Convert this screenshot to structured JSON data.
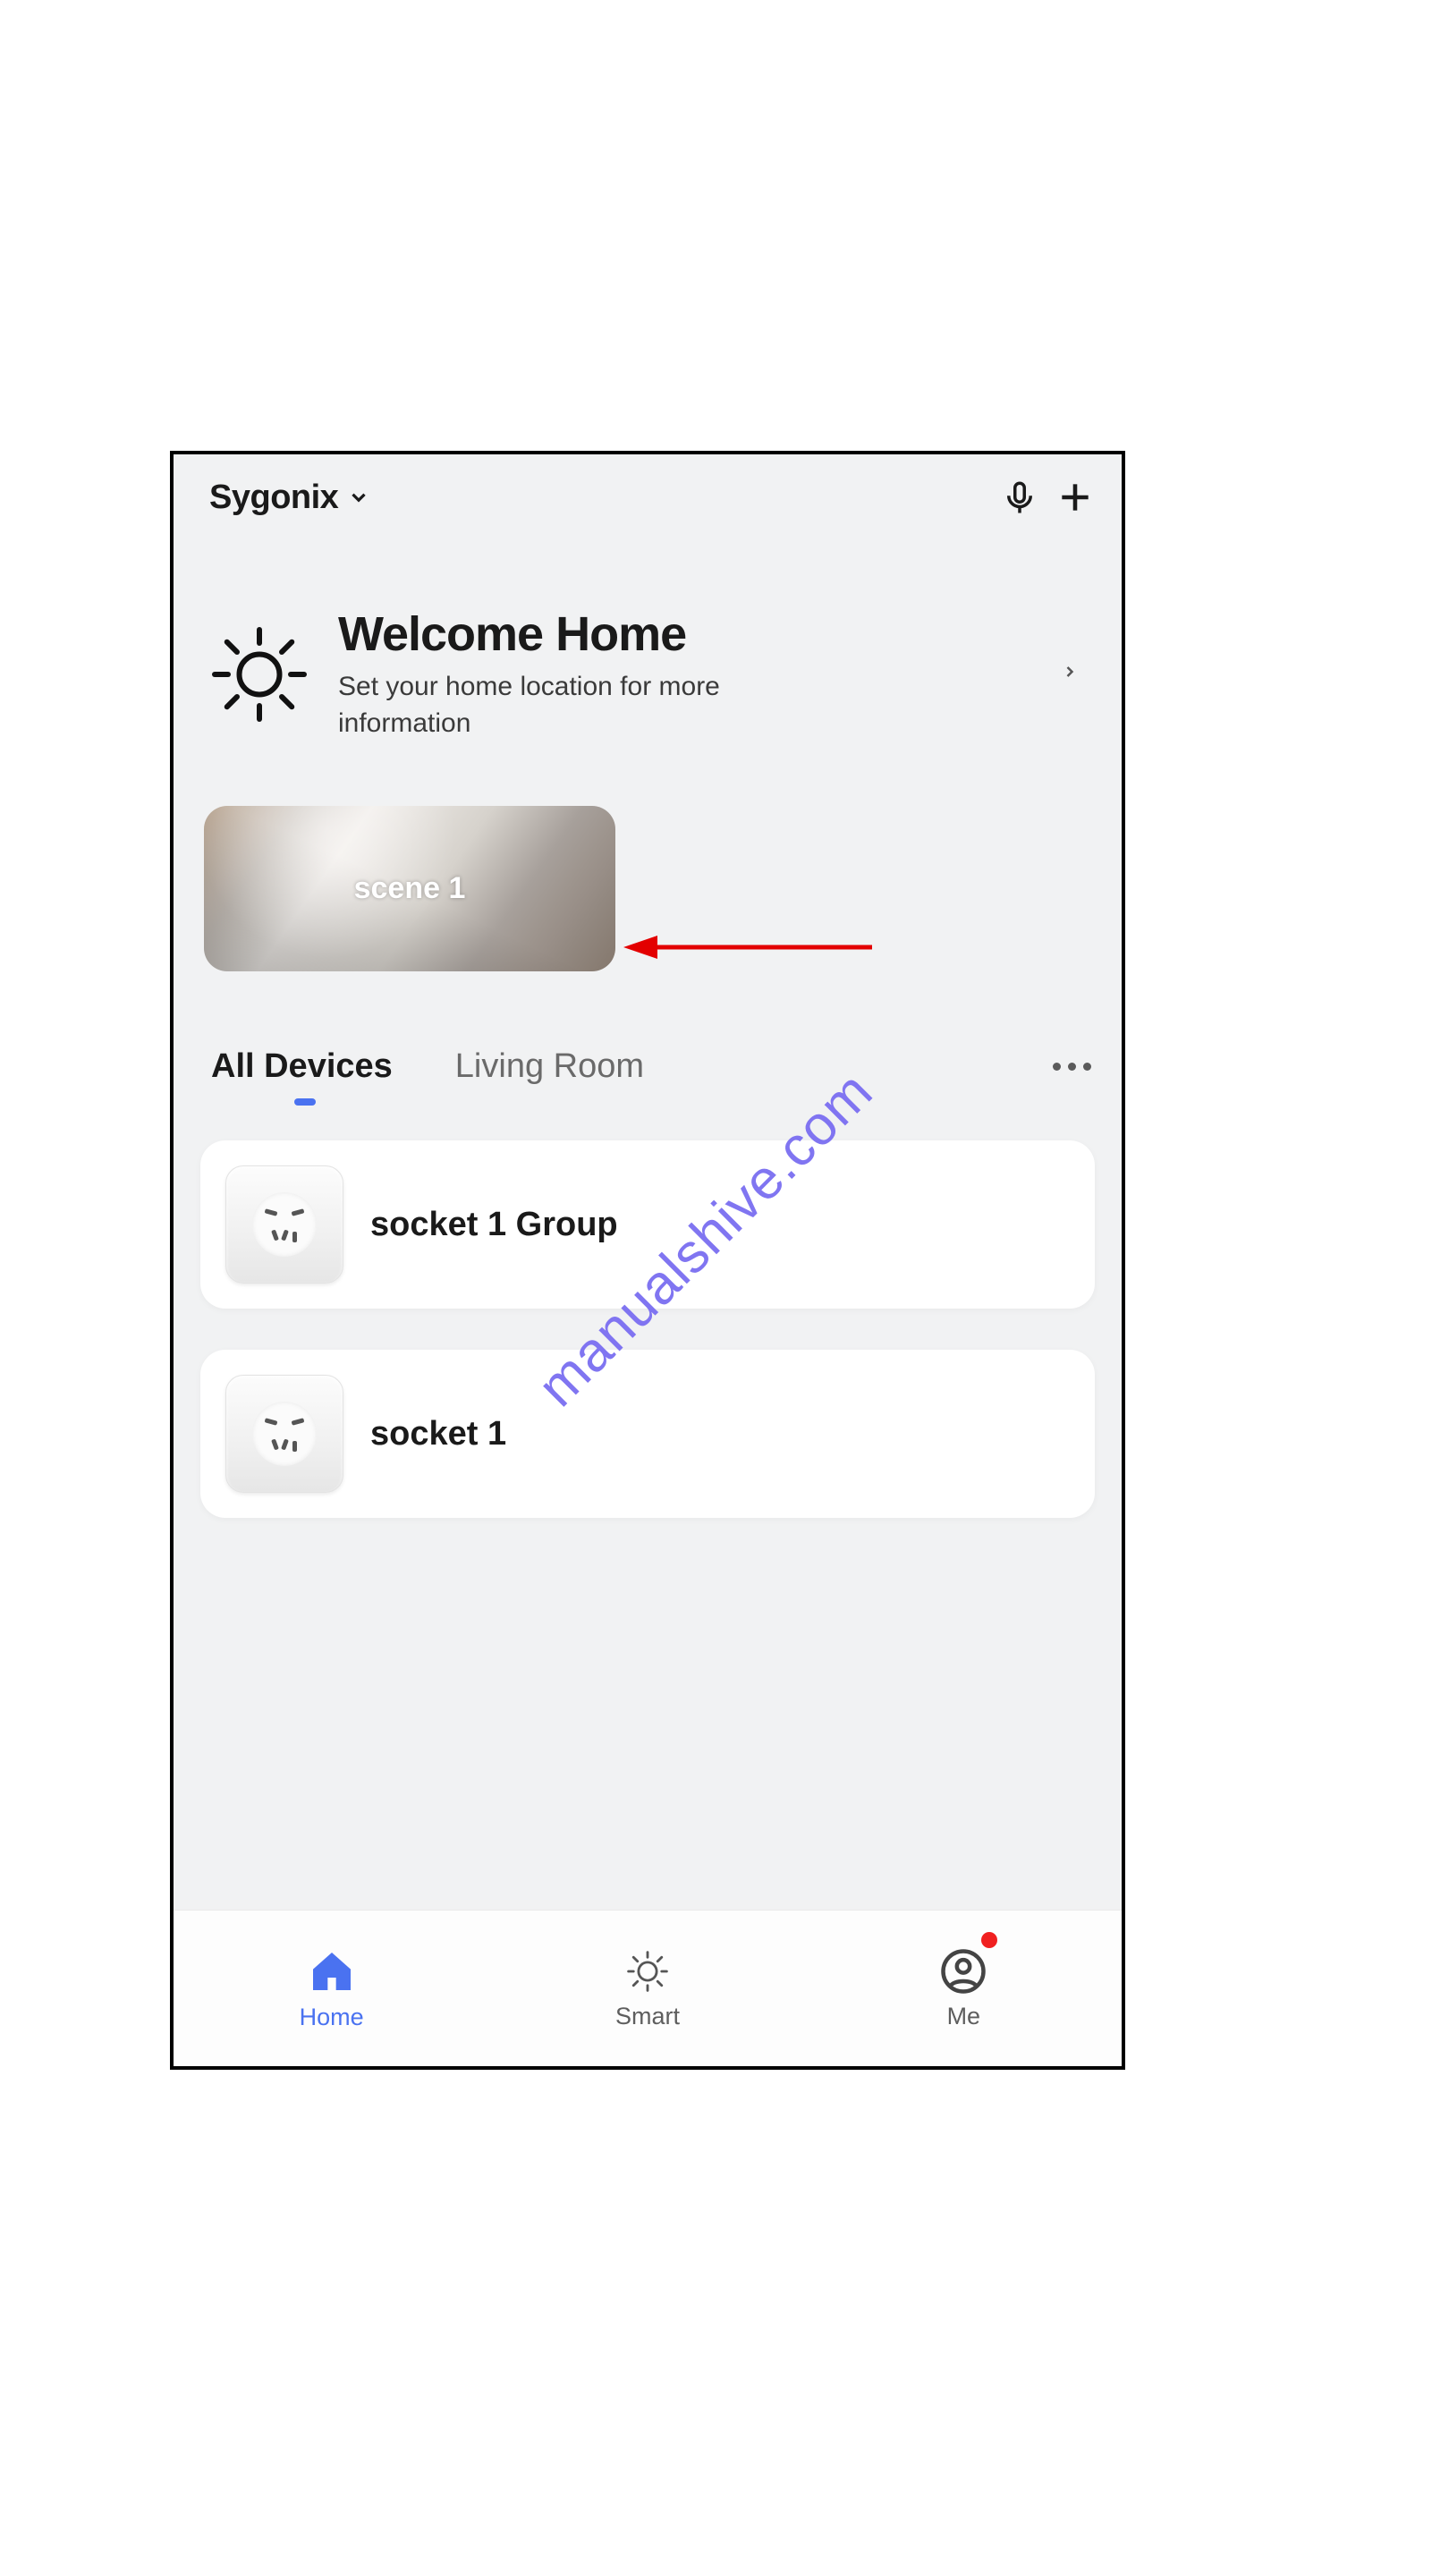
{
  "header": {
    "home_name": "Sygonix"
  },
  "welcome": {
    "title": "Welcome Home",
    "subtitle": "Set your home location for more information"
  },
  "scene": {
    "label": "scene 1"
  },
  "tabs": [
    {
      "label": "All Devices",
      "active": true
    },
    {
      "label": "Living Room",
      "active": false
    }
  ],
  "devices": [
    {
      "name": "socket 1 Group"
    },
    {
      "name": "socket 1"
    }
  ],
  "nav": [
    {
      "label": "Home",
      "icon": "house",
      "active": true,
      "badge": false
    },
    {
      "label": "Smart",
      "icon": "sun",
      "active": false,
      "badge": false
    },
    {
      "label": "Me",
      "icon": "person",
      "active": false,
      "badge": true
    }
  ],
  "watermark": "manualshive.com",
  "annotation": {
    "arrow_color": "#e30000"
  }
}
